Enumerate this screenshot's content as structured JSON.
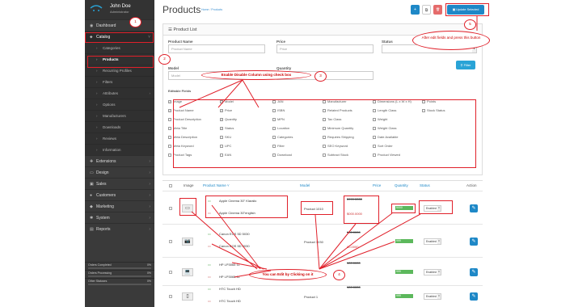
{
  "sidebar": {
    "user_name": "John Doe",
    "user_role": "Administrator",
    "items": [
      {
        "label": "Dashboard",
        "icon": "dashboard-icon",
        "glyph": "◉"
      },
      {
        "label": "Catalog",
        "icon": "tag-icon",
        "glyph": "⬥"
      },
      {
        "label": "Categories"
      },
      {
        "label": "Products"
      },
      {
        "label": "Recurring Profiles"
      },
      {
        "label": "Filters"
      },
      {
        "label": "Attributes"
      },
      {
        "label": "Options"
      },
      {
        "label": "Manufacturers"
      },
      {
        "label": "Downloads"
      },
      {
        "label": "Reviews"
      },
      {
        "label": "Information"
      },
      {
        "label": "Extensions",
        "icon": "puzzle-icon",
        "glyph": "✚"
      },
      {
        "label": "Design",
        "icon": "desktop-icon",
        "glyph": "▭"
      },
      {
        "label": "Sales",
        "icon": "cart-icon",
        "glyph": "▣"
      },
      {
        "label": "Customers",
        "icon": "user-icon",
        "glyph": "●"
      },
      {
        "label": "Marketing",
        "icon": "share-icon",
        "glyph": "◆"
      },
      {
        "label": "System",
        "icon": "gear-icon",
        "glyph": "✱"
      },
      {
        "label": "Reports",
        "icon": "chart-icon",
        "glyph": "▤"
      }
    ],
    "stats": [
      {
        "label": "Orders Completed",
        "pct": "0%"
      },
      {
        "label": "Orders Processing",
        "pct": "0%"
      },
      {
        "label": "Other Statuses",
        "pct": "0%"
      }
    ]
  },
  "header": {
    "title": "Products",
    "bc_home": "Home",
    "bc_sep": " / ",
    "bc_current": "Products",
    "add": "+",
    "copy": "⧉",
    "delete": "🗑",
    "update": "Update Selected"
  },
  "panel": {
    "title": "Product List",
    "filter": {
      "product_name_label": "Product Name",
      "product_name_placeholder": "Product Name",
      "price_label": "Price",
      "price_placeholder": "Price",
      "status_label": "Status",
      "model_label": "Model",
      "model_placeholder": "Model",
      "quantity_label": "Quantity",
      "quantity_placeholder": "Quantity",
      "filter_button": "Filter"
    },
    "editable_title": "Editable Fields",
    "checkboxes": [
      {
        "label": "Image",
        "checked": true
      },
      {
        "label": "Model",
        "checked": true
      },
      {
        "label": "JAN",
        "checked": false
      },
      {
        "label": "Manufacturer",
        "checked": false
      },
      {
        "label": "Dimensions (L x W x H)",
        "checked": false
      },
      {
        "label": "Points",
        "checked": false
      },
      {
        "label": "Product Name",
        "checked": true
      },
      {
        "label": "Price",
        "checked": true
      },
      {
        "label": "ISBN",
        "checked": false
      },
      {
        "label": "Related Products",
        "checked": false
      },
      {
        "label": "Length Class",
        "checked": false
      },
      {
        "label": "Stock Status",
        "checked": false
      },
      {
        "label": "Product Description",
        "checked": false
      },
      {
        "label": "Quantity",
        "checked": true
      },
      {
        "label": "MPN",
        "checked": false
      },
      {
        "label": "Tax Class",
        "checked": false
      },
      {
        "label": "Weight",
        "checked": false
      },
      {
        "label": "",
        "checked": false
      },
      {
        "label": "Meta Title",
        "checked": false
      },
      {
        "label": "Status",
        "checked": true
      },
      {
        "label": "Location",
        "checked": false
      },
      {
        "label": "Minimum Quantity",
        "checked": false
      },
      {
        "label": "Weight Class",
        "checked": false
      },
      {
        "label": "",
        "checked": false
      },
      {
        "label": "Meta Description",
        "checked": false
      },
      {
        "label": "SKU",
        "checked": false
      },
      {
        "label": "Categories",
        "checked": false
      },
      {
        "label": "Requires Shipping",
        "checked": false
      },
      {
        "label": "Date Available",
        "checked": false
      },
      {
        "label": "",
        "checked": false
      },
      {
        "label": "Meta Keyword",
        "checked": false
      },
      {
        "label": "UPC",
        "checked": false
      },
      {
        "label": "Filter",
        "checked": false
      },
      {
        "label": "SEO Keyword",
        "checked": false
      },
      {
        "label": "Sort Order",
        "checked": false
      },
      {
        "label": "",
        "checked": false
      },
      {
        "label": "Product Tags",
        "checked": false
      },
      {
        "label": "EAN",
        "checked": false
      },
      {
        "label": "Download",
        "checked": false
      },
      {
        "label": "Subtract Stock",
        "checked": false
      },
      {
        "label": "Product Viewed",
        "checked": false
      },
      {
        "label": "",
        "checked": false
      }
    ]
  },
  "table": {
    "headers": {
      "image": "Image",
      "name": "Product Name ˅",
      "model": "Model",
      "price": "Price",
      "quantity": "Quantity",
      "status": "Status",
      "action": "Action"
    },
    "rows": [
      {
        "name1": "Apple Cinema 30\" Klaralic",
        "name2": "Apple Cinema 30\"english",
        "model": "Product 1010",
        "price": "5999.0000",
        "price2": "$000.0000",
        "qty": "5000",
        "status": "Enabled"
      },
      {
        "name1": "Canon EOS 5D 5030",
        "name2": "Canon EOS 5D 5030",
        "model": "Product 3030",
        "price": "100.0000",
        "price2": "80.0000",
        "qty": "999",
        "status": "Enabled"
      },
      {
        "name1": "HP LP3065 11",
        "name2": "HP LP3065 11",
        "model": "Product 21",
        "price": "100.0000",
        "price2": "",
        "qty": "999",
        "status": "Enabled"
      },
      {
        "name1": "HTC Touch HD",
        "name2": "HTC Touch HD",
        "model": "Product 1",
        "price": "100.0000",
        "price2": "",
        "qty": "999",
        "status": "Enabled"
      }
    ]
  },
  "annotations": {
    "n1": "1",
    "n2": "2",
    "n3": "3",
    "n4": "4",
    "n5": "5",
    "enable_disable": "Enable Disable Column using check box",
    "after_edit": "After edit fields and press this button",
    "edit_click": "You can Edit by Clicking on it"
  }
}
